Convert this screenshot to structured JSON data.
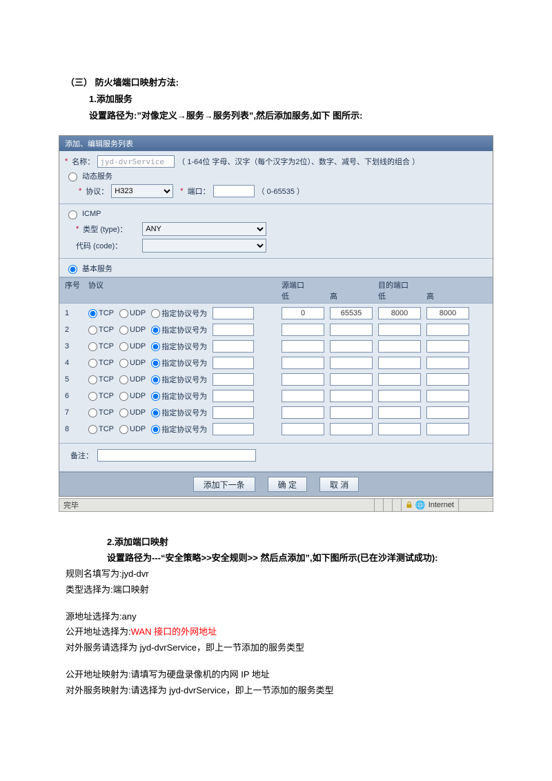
{
  "intro": {
    "heading": "（三） 防火墙端口映射方法:",
    "line1": "1.添加服务",
    "line2": "设置路径为:”对像定义→服务→服务列表”,然后添加服务,如下  图所示:"
  },
  "form": {
    "title": "添加、编辑服务列表",
    "name_lbl": "名称：",
    "name_val": "jyd-dvrService",
    "name_hint": "（ 1-64位  字母、汉字（每个汉字为2位）、数字、减号、下划线的组合 ）",
    "dyn_service": "动态服务",
    "proto_lbl": "协议：",
    "proto_val": "H323",
    "port_lbl": "端口：",
    "port_hint": "（ 0-65535 ）",
    "icmp": "ICMP",
    "type_lbl": "类型 (type)：",
    "type_val": "ANY",
    "code_lbl": "代码 (code)：",
    "basic": "基本服务",
    "col_seq": "序号",
    "col_proto": "协议",
    "col_src": "源端口",
    "col_dst": "目的端口",
    "col_lo": "低",
    "col_hi": "高",
    "tcp": "TCP",
    "udp": "UDP",
    "custom": "指定协议号为",
    "remark_lbl": "备注：",
    "btn_add": "添加下一条",
    "btn_ok": "确 定",
    "btn_cancel": "取 消",
    "rows": [
      {
        "seq": "1",
        "sel": "tcp",
        "src_lo": "0",
        "src_hi": "65535",
        "dst_lo": "8000",
        "dst_hi": "8000"
      },
      {
        "seq": "2",
        "sel": "custom",
        "src_lo": "",
        "src_hi": "",
        "dst_lo": "",
        "dst_hi": ""
      },
      {
        "seq": "3",
        "sel": "custom",
        "src_lo": "",
        "src_hi": "",
        "dst_lo": "",
        "dst_hi": ""
      },
      {
        "seq": "4",
        "sel": "custom",
        "src_lo": "",
        "src_hi": "",
        "dst_lo": "",
        "dst_hi": ""
      },
      {
        "seq": "5",
        "sel": "custom",
        "src_lo": "",
        "src_hi": "",
        "dst_lo": "",
        "dst_hi": ""
      },
      {
        "seq": "6",
        "sel": "custom",
        "src_lo": "",
        "src_hi": "",
        "dst_lo": "",
        "dst_hi": ""
      },
      {
        "seq": "7",
        "sel": "custom",
        "src_lo": "",
        "src_hi": "",
        "dst_lo": "",
        "dst_hi": ""
      },
      {
        "seq": "8",
        "sel": "custom",
        "src_lo": "",
        "src_hi": "",
        "dst_lo": "",
        "dst_hi": ""
      }
    ]
  },
  "ie": {
    "status": "完毕",
    "zone": "Internet"
  },
  "outro": {
    "h1": "2.添加端口映射",
    "h2": "设置路径为---“安全策略>>安全规则>>  然后点添加”,如下图所示(已在沙洋测试成功):",
    "l1": "规则名填写为:jyd-dvr",
    "l2": "类型选择为:端口映射",
    "l3": "源地址选择为:any",
    "l4a": "公开地址选择为:",
    "l4b": "WAN 接口的外网地址",
    "l5": "对外服务请选择为 jyd-dvrService，即上一节添加的服务类型",
    "l6": "公开地址映射为:请填写为硬盘录像机的内网 IP 地址",
    "l7": "对外服务映射为:请选择为 jyd-dvrService，即上一节添加的服务类型"
  }
}
